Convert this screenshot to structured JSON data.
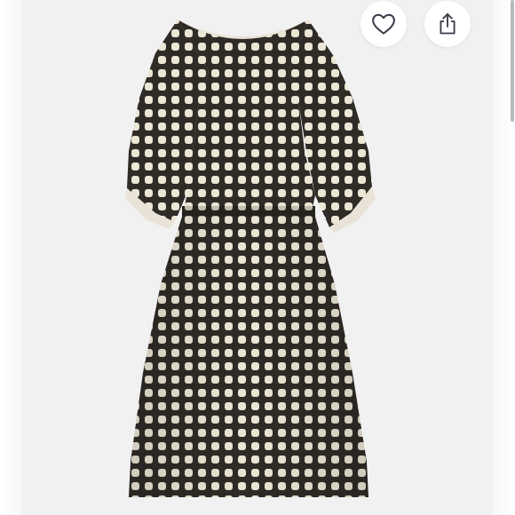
{
  "listing": {
    "image_icon": "dress-photo",
    "background_color": "#f1f1f1",
    "dress_colors": {
      "base": "#2f2b27",
      "print": "#ece6d4",
      "lining": "#e8e3d6"
    }
  },
  "actions": {
    "like_icon": "heart-outline-icon",
    "share_icon": "share-upload-icon"
  },
  "scroll": {
    "position": 0
  }
}
